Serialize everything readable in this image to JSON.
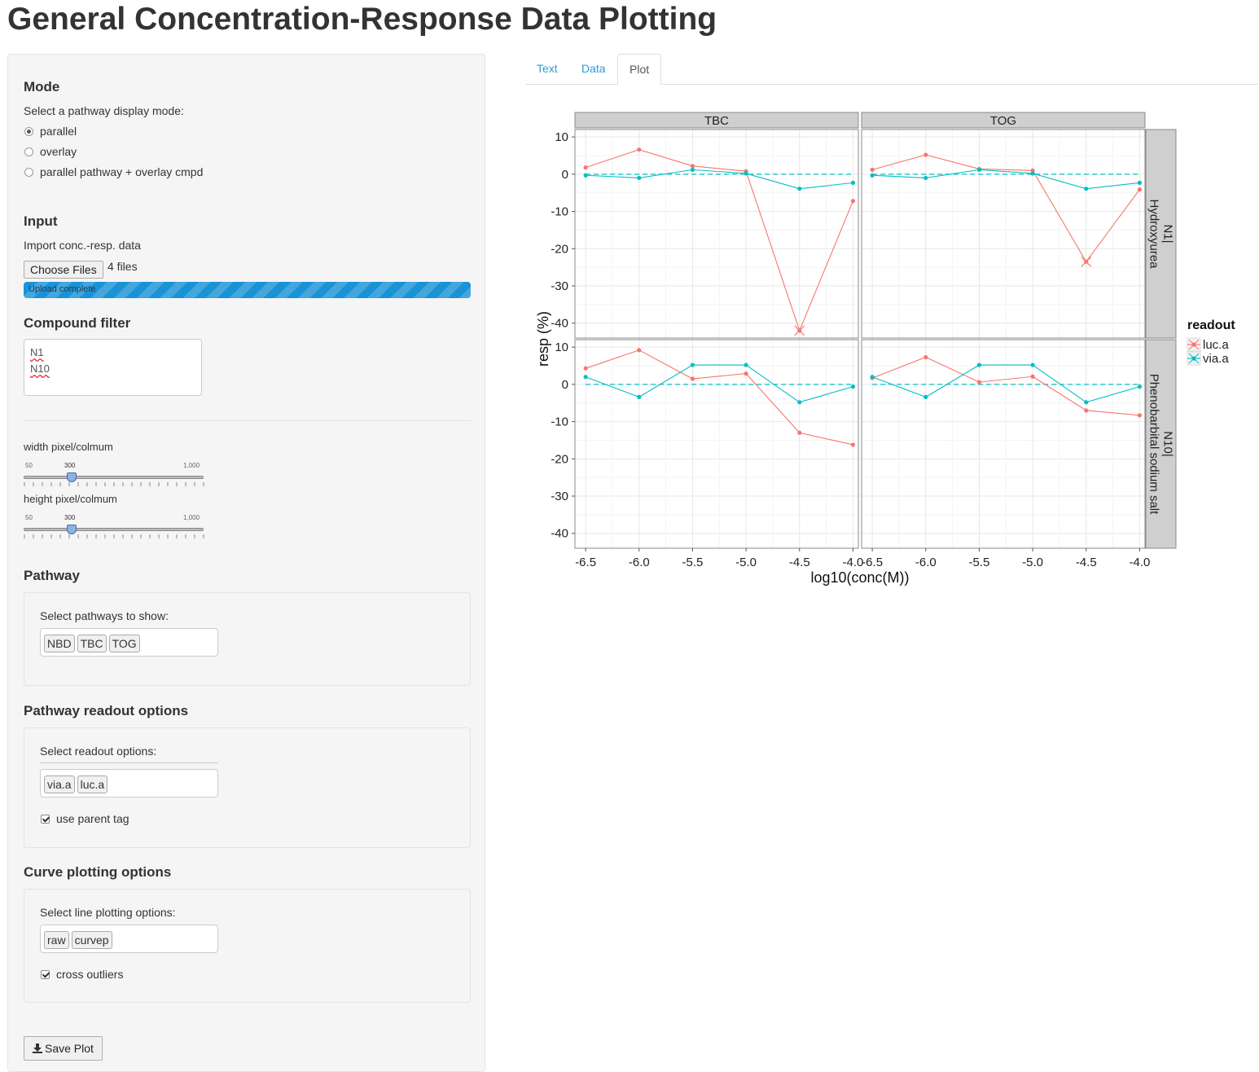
{
  "title": "General Concentration-Response Data Plotting",
  "mode": {
    "heading": "Mode",
    "prompt": "Select a pathway display mode:",
    "options": [
      "parallel",
      "overlay",
      "parallel pathway + overlay cmpd"
    ],
    "selected": "parallel"
  },
  "input": {
    "heading": "Input",
    "prompt": "Import conc.-resp. data",
    "button_label": "Choose Files",
    "file_count": "4 files",
    "progress_label": "Upload complete",
    "progress": 100
  },
  "compound_filter": {
    "heading": "Compound filter",
    "lines": [
      "N1",
      "N10"
    ]
  },
  "width_slider": {
    "label": "width pixel/colmum",
    "min_label": "50",
    "value_label": "300",
    "max_label": "1,000",
    "min": 50,
    "max": 1000,
    "value": 300
  },
  "height_slider": {
    "label": "height pixel/colmum",
    "min_label": "50",
    "value_label": "300",
    "max_label": "1,000",
    "min": 50,
    "max": 1000,
    "value": 300
  },
  "pathway": {
    "heading": "Pathway",
    "prompt": "Select pathways to show:",
    "selected": [
      "NBD",
      "TBC",
      "TOG"
    ]
  },
  "readout": {
    "heading": "Pathway readout options",
    "prompt": "Select readout options:",
    "selected": [
      "via.a",
      "luc.a"
    ],
    "checkbox_label": "use parent tag",
    "checked": true
  },
  "curve": {
    "heading": "Curve plotting options",
    "prompt": "Select line plotting options:",
    "selected": [
      "raw",
      "curvep"
    ],
    "checkbox_label": "cross outliers",
    "checked": true
  },
  "save_label": "Save Plot",
  "tabs": [
    "Text",
    "Data",
    "Plot"
  ],
  "active_tab": "Plot",
  "colors": {
    "luc": "#f8766d",
    "via": "#00bfc4",
    "accent": "#2a9fd6",
    "progress": "#1a93d6"
  },
  "chart_data": {
    "type": "line",
    "xlabel": "log10(conc(M))",
    "ylabel": "resp (%)",
    "xlim": [
      -6.6,
      -3.95
    ],
    "ylim": [
      -44,
      12
    ],
    "xticks": [
      -6.5,
      -6.0,
      -5.5,
      -5.0,
      -4.5,
      -4.0
    ],
    "xtick_labels": [
      "-6.5",
      "-6.0",
      "-5.5",
      "-5.0",
      "-4.5",
      "-4.0"
    ],
    "yticks": [
      10,
      0,
      -10,
      -20,
      -30,
      -40
    ],
    "ytick_labels": [
      "10",
      "0",
      "-10",
      "-20",
      "-30",
      "-40"
    ],
    "col_facets": [
      "TBC",
      "TOG"
    ],
    "row_facets": [
      "N1|\nHydroxyurea",
      "N10|\nPhenobarbital sodium salt"
    ],
    "row_facet_lines": [
      [
        "N1|",
        "Hydroxyurea"
      ],
      [
        "N10|",
        "Phenobarbital sodium salt"
      ]
    ],
    "legend": {
      "title": "readout",
      "entries": [
        "luc.a",
        "via.a"
      ],
      "position": "right"
    },
    "x": [
      -6.5,
      -6.0,
      -5.5,
      -5.0,
      -4.5,
      -4.0
    ],
    "reference_line": 0,
    "panels": [
      {
        "row": 0,
        "col": 0,
        "series": [
          {
            "name": "luc.a",
            "values": [
              1.8,
              6.6,
              2.2,
              0.8,
              -42.0,
              -7.2
            ],
            "outliers": [
              4
            ]
          },
          {
            "name": "via.a",
            "values": [
              -0.3,
              -1.0,
              1.2,
              0.2,
              -3.9,
              -2.3
            ],
            "outliers": []
          }
        ]
      },
      {
        "row": 0,
        "col": 1,
        "series": [
          {
            "name": "luc.a",
            "values": [
              1.2,
              5.2,
              1.4,
              1.0,
              -23.5,
              -4.1
            ],
            "outliers": [
              4
            ]
          },
          {
            "name": "via.a",
            "values": [
              -0.3,
              -1.0,
              1.2,
              0.2,
              -3.9,
              -2.3
            ],
            "outliers": []
          }
        ]
      },
      {
        "row": 1,
        "col": 0,
        "series": [
          {
            "name": "luc.a",
            "values": [
              4.3,
              9.2,
              1.5,
              2.9,
              -13.0,
              -16.2
            ],
            "outliers": []
          },
          {
            "name": "via.a",
            "values": [
              2.0,
              -3.4,
              5.2,
              5.2,
              -4.8,
              -0.6
            ],
            "outliers": []
          }
        ]
      },
      {
        "row": 1,
        "col": 1,
        "series": [
          {
            "name": "luc.a",
            "values": [
              1.7,
              7.3,
              0.6,
              2.1,
              -7.0,
              -8.3
            ],
            "outliers": []
          },
          {
            "name": "via.a",
            "values": [
              2.0,
              -3.4,
              5.2,
              5.2,
              -4.8,
              -0.6
            ],
            "outliers": []
          }
        ]
      }
    ]
  }
}
